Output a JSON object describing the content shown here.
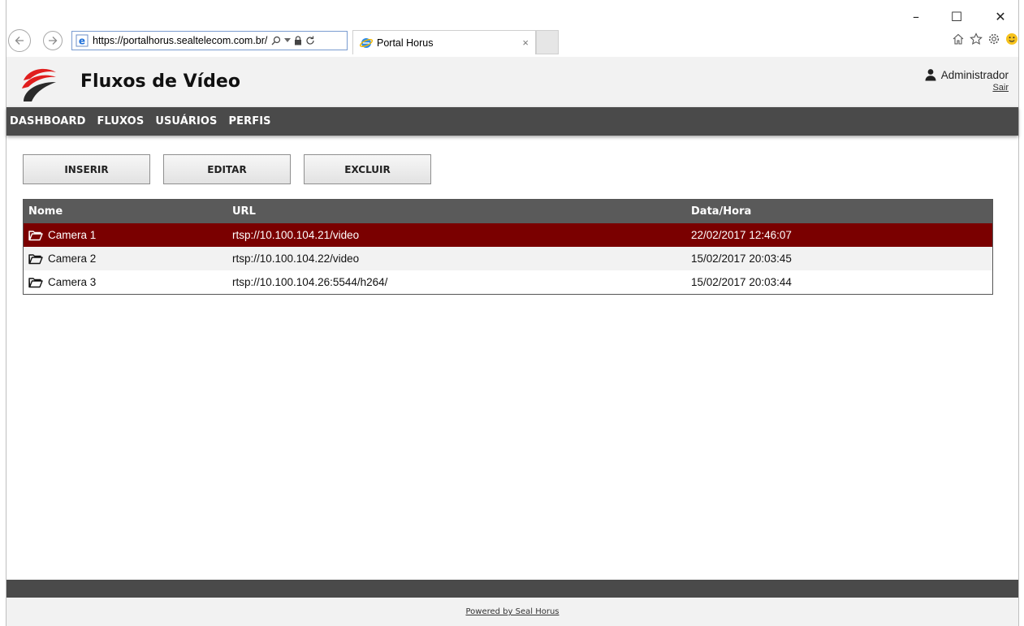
{
  "browser": {
    "url": "https://portalhorus.sealtelecom.com.br/",
    "tab_title": "Portal Horus",
    "tab_close": "×",
    "window_controls": {
      "minimize": "–",
      "maximize": "☐",
      "close": "✕"
    }
  },
  "header": {
    "title": "Fluxos de Vídeo",
    "user_name": "Administrador",
    "logout_label": "Sair"
  },
  "menu": {
    "items": [
      {
        "label": "DASHBOARD"
      },
      {
        "label": "FLUXOS"
      },
      {
        "label": "USUÁRIOS"
      },
      {
        "label": "PERFIS"
      }
    ]
  },
  "toolbar": {
    "insert_label": "INSERIR",
    "edit_label": "EDITAR",
    "delete_label": "EXCLUIR"
  },
  "table": {
    "columns": [
      "Nome",
      "URL",
      "Data/Hora"
    ],
    "rows": [
      {
        "name": "Camera 1",
        "url": "rtsp://10.100.104.21/video",
        "datetime": "22/02/2017 12:46:07",
        "selected": true
      },
      {
        "name": "Camera 2",
        "url": "rtsp://10.100.104.22/video",
        "datetime": "15/02/2017 20:03:45",
        "selected": false
      },
      {
        "name": "Camera 3",
        "url": "rtsp://10.100.104.26:5544/h264/",
        "datetime": "15/02/2017 20:03:44",
        "selected": false
      }
    ]
  },
  "footer": {
    "powered_by": "Powered by Seal Horus"
  },
  "colors": {
    "menu_bg": "#4a4a4a",
    "selected_row": "#7a0000",
    "logo_red": "#e01e1e"
  }
}
